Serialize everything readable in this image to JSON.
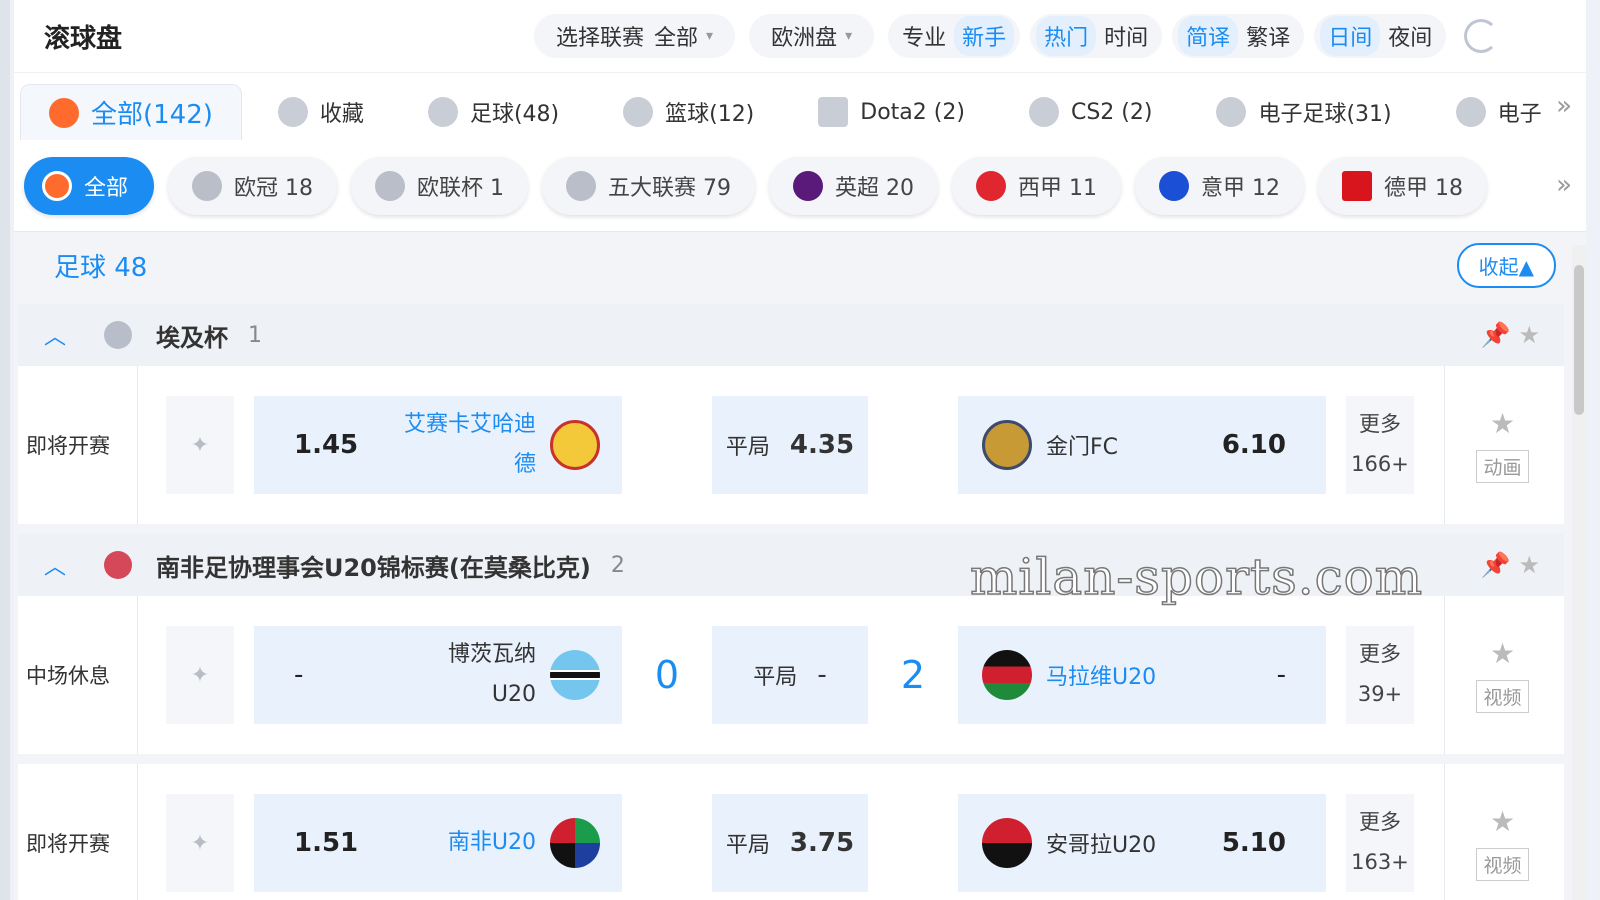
{
  "header": {
    "title": "滚球盘",
    "league_select": {
      "label": "选择联赛",
      "value": "全部"
    },
    "odds_type": "欧洲盘",
    "mode": [
      "专业",
      "新手"
    ],
    "sort": [
      "热门",
      "时间"
    ],
    "lang": [
      "简译",
      "繁译"
    ],
    "theme": [
      "日间",
      "夜间"
    ]
  },
  "sport_tabs": [
    {
      "label": "全部(142)"
    },
    {
      "label": "收藏"
    },
    {
      "label": "足球(48)"
    },
    {
      "label": "篮球(12)"
    },
    {
      "label": "Dota2 (2)"
    },
    {
      "label": "CS2 (2)"
    },
    {
      "label": "电子足球(31)"
    },
    {
      "label": "电子"
    }
  ],
  "league_chips": [
    {
      "label": "全部"
    },
    {
      "label": "欧冠 18"
    },
    {
      "label": "欧联杯 1"
    },
    {
      "label": "五大联赛 79"
    },
    {
      "label": "英超 20"
    },
    {
      "label": "西甲 11"
    },
    {
      "label": "意甲 12"
    },
    {
      "label": "德甲 18"
    }
  ],
  "section": {
    "title": "足球 48",
    "collapse_label": "收起▲"
  },
  "leagues": [
    {
      "name": "埃及杯",
      "count": "1",
      "matches": [
        {
          "status": "即将开赛",
          "home_odds": "1.45",
          "home_team": "艾赛卡艾哈迪德",
          "draw_label": "平局",
          "draw_odds": "4.35",
          "away_team": "金门FC",
          "away_odds": "6.10",
          "more_label": "更多",
          "more_count": "166+",
          "media": "动画"
        }
      ]
    },
    {
      "name": "南非足协理事会U20锦标赛(在莫桑比克)",
      "count": "2",
      "matches": [
        {
          "status": "中场休息",
          "home_odds": "-",
          "home_team": "博茨瓦纳U20",
          "home_score": "0",
          "draw_label": "平局",
          "draw_odds": "-",
          "away_score": "2",
          "away_team": "马拉维U20",
          "away_odds": "-",
          "more_label": "更多",
          "more_count": "39+",
          "media": "视频"
        },
        {
          "status": "即将开赛",
          "home_odds": "1.51",
          "home_team": "南非U20",
          "draw_label": "平局",
          "draw_odds": "3.75",
          "away_team": "安哥拉U20",
          "away_odds": "5.10",
          "more_label": "更多",
          "more_count": "163+",
          "media": "视频"
        }
      ]
    }
  ],
  "watermark": "milan-sports.com",
  "colors": {
    "accent": "#1b8cf2",
    "odds_bg": "#e8f1fc",
    "orange": "#ff6b2d"
  }
}
